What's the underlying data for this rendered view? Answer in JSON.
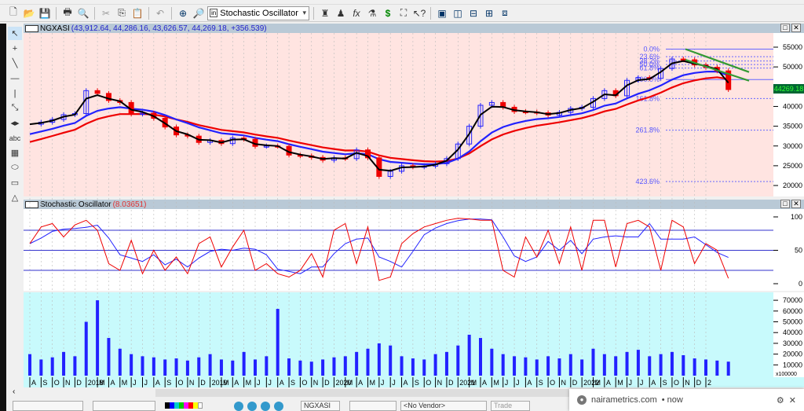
{
  "toolbar": {
    "indicator_select": "Stochastic Oscillator"
  },
  "price_pane": {
    "symbol": "NGXASI",
    "ohlc": "(43,912.64, 44,286.16, 43,626.57, 44,269.18, +356.539)",
    "last_price": "44269.18"
  },
  "stoch_pane": {
    "title": "Stochastic Oscillator",
    "value": "(8.03651)"
  },
  "volume_pane": {
    "multiplier": "x100000"
  },
  "bottom": {
    "symbol": "NGXASI",
    "vendor": "<No Vendor>",
    "trade": "Trade"
  },
  "notification": {
    "site": "nairametrics.com",
    "time": "• now"
  },
  "chart_data": [
    {
      "type": "line",
      "name": "price",
      "series_name": "NGXASI monthly close (approx)",
      "start": "2017-08",
      "values": [
        35500,
        36000,
        36700,
        37900,
        38200,
        44000,
        43300,
        41500,
        41000,
        38100,
        38300,
        37000,
        34800,
        32800,
        32500,
        30900,
        31400,
        30600,
        32000,
        31700,
        29900,
        30000,
        29900,
        27700,
        27500,
        27100,
        26400,
        27000,
        26800,
        29000,
        27000,
        22300,
        23600,
        25000,
        24700,
        24900,
        25500,
        26800,
        30500,
        35000,
        40300,
        41000,
        39800,
        38700,
        38600,
        38400,
        37800,
        38500,
        39500,
        39800,
        42000,
        44000,
        42700,
        46600,
        47300,
        47100,
        49600,
        52000,
        51800,
        50500,
        49900,
        49000,
        44269
      ],
      "yticks": [
        20000,
        25000,
        30000,
        35000,
        40000,
        45000,
        50000,
        55000
      ],
      "ylim": [
        18500,
        57500
      ],
      "fib_levels": [
        {
          "label": "0.0%",
          "value": 54500
        },
        {
          "label": "23.6%",
          "value": 52600
        },
        {
          "label": "38.2%",
          "value": 51500
        },
        {
          "label": "50.0%",
          "value": 50600
        },
        {
          "label": "61.8%",
          "value": 49700
        },
        {
          "label": "100.0%",
          "value": 46800
        },
        {
          "label": "161.8%",
          "value": 42000
        },
        {
          "label": "261.8%",
          "value": 34000
        },
        {
          "label": "423.6%",
          "value": 21000
        }
      ]
    },
    {
      "type": "line",
      "name": "stochastic",
      "values": [
        60,
        85,
        90,
        70,
        88,
        95,
        80,
        30,
        20,
        65,
        15,
        50,
        20,
        40,
        15,
        60,
        70,
        25,
        55,
        80,
        20,
        30,
        15,
        10,
        20,
        45,
        10,
        80,
        90,
        30,
        85,
        5,
        10,
        60,
        75,
        85,
        90,
        95,
        98,
        97,
        95,
        95,
        20,
        10,
        70,
        40,
        80,
        30,
        85,
        20,
        95,
        95,
        25,
        90,
        95,
        85,
        20,
        95,
        85,
        30,
        60,
        50,
        8
      ],
      "levels": [
        20,
        50,
        80
      ],
      "yticks": [
        0,
        50,
        100
      ],
      "ylim": [
        0,
        100
      ]
    },
    {
      "type": "bar",
      "name": "volume",
      "values": [
        20000,
        15000,
        17000,
        22000,
        18000,
        50000,
        70000,
        35000,
        25000,
        20000,
        18000,
        17000,
        15000,
        16000,
        14000,
        17000,
        20000,
        15000,
        14000,
        22000,
        15000,
        18000,
        62000,
        16000,
        14000,
        13000,
        15000,
        17000,
        18000,
        22000,
        25000,
        30000,
        28000,
        18000,
        16000,
        15000,
        20000,
        22000,
        28000,
        38000,
        35000,
        25000,
        20000,
        18000,
        17000,
        15000,
        18000,
        16000,
        20000,
        15000,
        25000,
        20000,
        18000,
        22000,
        24000,
        18000,
        20000,
        22000,
        19000,
        16000,
        15000,
        14000,
        13000
      ],
      "yticks": [
        10000,
        20000,
        30000,
        40000,
        50000,
        60000,
        70000
      ],
      "ylim": [
        0,
        75000
      ]
    },
    {
      "type": "axis",
      "name": "date-axis",
      "labels": [
        "A",
        "S",
        "O",
        "N",
        "D",
        "2018",
        "M",
        "A",
        "M",
        "J",
        "J",
        "A",
        "S",
        "O",
        "N",
        "D",
        "2019",
        "M",
        "A",
        "M",
        "J",
        "J",
        "A",
        "S",
        "O",
        "N",
        "D",
        "2020",
        "M",
        "A",
        "M",
        "J",
        "J",
        "A",
        "S",
        "O",
        "N",
        "D",
        "2021",
        "M",
        "A",
        "M",
        "J",
        "J",
        "A",
        "S",
        "O",
        "N",
        "D",
        "2022",
        "M",
        "A",
        "M",
        "J",
        "J",
        "A",
        "S",
        "O",
        "N",
        "D",
        "2"
      ]
    }
  ]
}
